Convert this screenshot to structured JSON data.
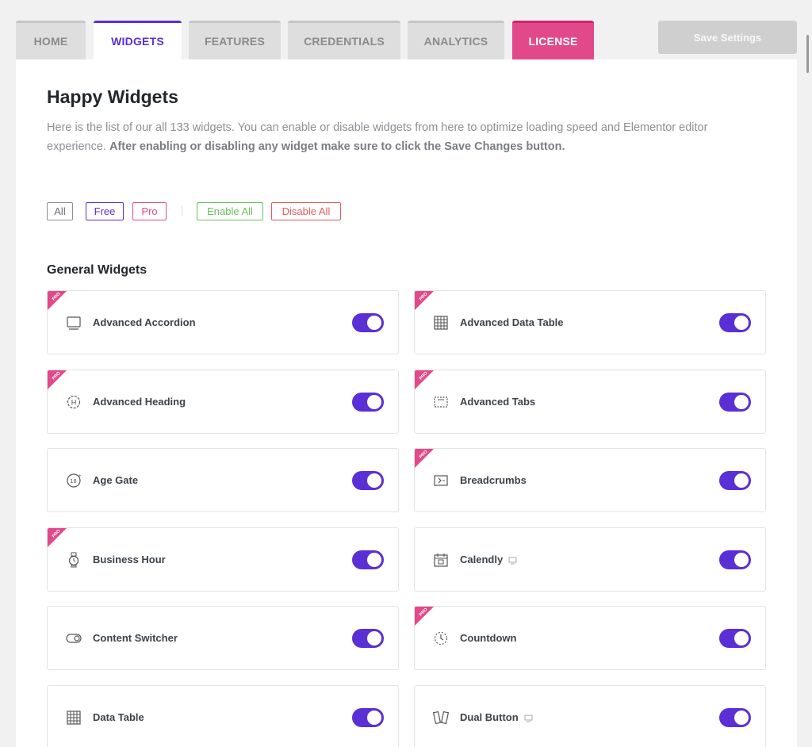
{
  "tabs": [
    {
      "label": "HOME"
    },
    {
      "label": "WIDGETS"
    },
    {
      "label": "FEATURES"
    },
    {
      "label": "CREDENTIALS"
    },
    {
      "label": "ANALYTICS"
    },
    {
      "label": "LICENSE"
    }
  ],
  "save_button": "Save Settings",
  "page": {
    "title": "Happy Widgets",
    "description": "Here is the list of our all 133 widgets. You can enable or disable widgets from here to optimize loading speed and Elementor editor experience.",
    "description_bold": "After enabling or disabling any widget make sure to click the Save Changes button."
  },
  "filters": {
    "all": "All",
    "free": "Free",
    "pro": "Pro",
    "enable_all": "Enable All",
    "disable_all": "Disable All"
  },
  "section_title": "General Widgets",
  "pro_badge": "PRO",
  "widgets": [
    {
      "label": "Advanced Accordion",
      "icon": "accordion-icon",
      "pro": true,
      "enabled": true
    },
    {
      "label": "Advanced Data Table",
      "icon": "data-table-icon",
      "pro": true,
      "enabled": true
    },
    {
      "label": "Advanced Heading",
      "icon": "heading-icon",
      "pro": true,
      "enabled": true
    },
    {
      "label": "Advanced Tabs",
      "icon": "tabs-icon",
      "pro": true,
      "enabled": true
    },
    {
      "label": "Age Gate",
      "icon": "age-gate-icon",
      "pro": false,
      "enabled": true
    },
    {
      "label": "Breadcrumbs",
      "icon": "breadcrumbs-icon",
      "pro": true,
      "enabled": true
    },
    {
      "label": "Business Hour",
      "icon": "watch-icon",
      "pro": true,
      "enabled": true
    },
    {
      "label": "Calendly",
      "icon": "calendar-icon",
      "pro": false,
      "enabled": true,
      "monitor": true
    },
    {
      "label": "Content Switcher",
      "icon": "switch-icon",
      "pro": false,
      "enabled": true
    },
    {
      "label": "Countdown",
      "icon": "countdown-icon",
      "pro": true,
      "enabled": true
    },
    {
      "label": "Data Table",
      "icon": "data-table-icon",
      "pro": false,
      "enabled": true
    },
    {
      "label": "Dual Button",
      "icon": "dual-button-icon",
      "pro": false,
      "enabled": true,
      "monitor": true
    }
  ],
  "colors": {
    "accent": "#5b2fd6",
    "license": "#e2498a",
    "pro_ribbon": "#e2498a",
    "enable": "#69c05b",
    "disable": "#e85a5a"
  }
}
